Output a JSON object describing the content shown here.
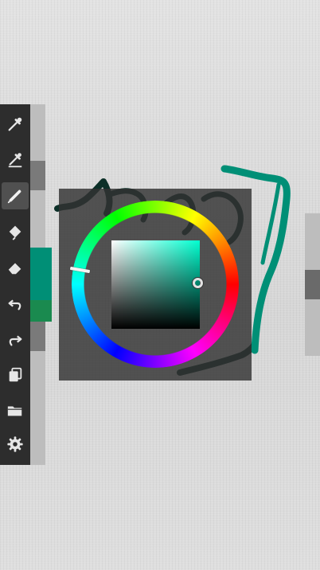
{
  "toolbar": {
    "tools": [
      {
        "name": "eyedropper",
        "icon": "eyedropper-icon",
        "active": false
      },
      {
        "name": "eyedropper-alt",
        "icon": "eyedropper-pen-icon",
        "active": false
      },
      {
        "name": "brush",
        "icon": "brush-icon",
        "active": true
      },
      {
        "name": "fill",
        "icon": "fill-bucket-icon",
        "active": false
      },
      {
        "name": "eraser",
        "icon": "eraser-icon",
        "active": false
      },
      {
        "name": "undo",
        "icon": "undo-icon",
        "active": false
      },
      {
        "name": "redo",
        "icon": "redo-icon",
        "active": false
      },
      {
        "name": "layers",
        "icon": "layers-icon",
        "active": false
      },
      {
        "name": "open",
        "icon": "folder-icon",
        "active": false
      },
      {
        "name": "settings",
        "icon": "gear-icon",
        "active": false
      }
    ]
  },
  "color": {
    "current": "#008f76",
    "previous": "#1a8a4f",
    "sv_square_hue": "#00ffd0",
    "ring_hue_degrees": 170,
    "saturation": 1.0,
    "value": 0.56
  },
  "brush": {
    "size_level": 0.4,
    "opacity_level": 0.45
  },
  "colors": {
    "toolbar_bg": "#2d2d2d",
    "active_tool": "#505050",
    "slider_track": "#bdbdbd",
    "slider_thumb": "#6a6a6a",
    "stroke_dark": "#0c3028",
    "stroke_teal": "#008f76"
  }
}
